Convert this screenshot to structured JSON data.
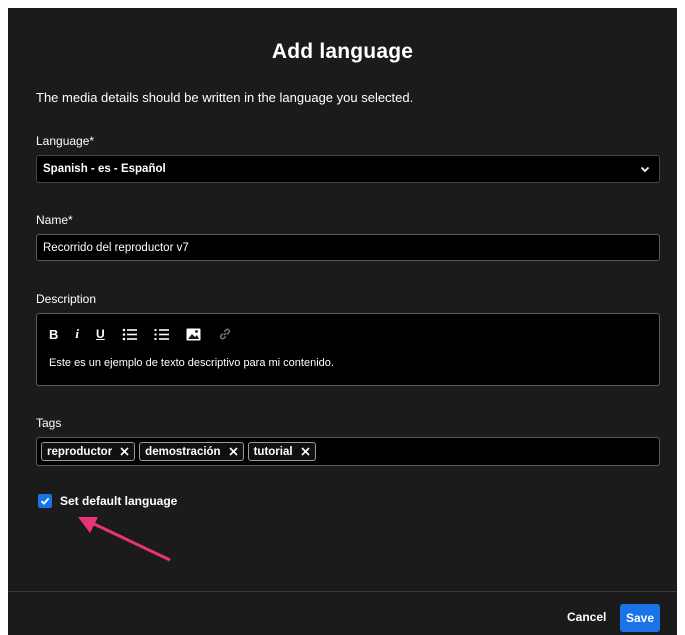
{
  "dialog": {
    "title": "Add language",
    "subtitle": "The media details should be written in the language you selected."
  },
  "language": {
    "label": "Language",
    "required_mark": "*",
    "value": "Spanish - es - Español",
    "icon": "chevron-down-icon"
  },
  "name": {
    "label": "Name",
    "required_mark": "*",
    "value": "Recorrido del reproductor v7"
  },
  "description": {
    "label": "Description",
    "toolbar": {
      "bold": "B",
      "italic": "i",
      "underline": "U",
      "bullet_list_icon": "bullet-list-icon",
      "numbered_list_icon": "numbered-list-icon",
      "image_icon": "image-icon",
      "link_icon": "link-icon"
    },
    "text": "Este es un ejemplo de texto descriptivo para mi contenido."
  },
  "tags": {
    "label": "Tags",
    "items": [
      "reproductor",
      "demostración",
      "tutorial"
    ]
  },
  "default_language": {
    "label": "Set default language",
    "checked": true
  },
  "footer": {
    "cancel_label": "Cancel",
    "save_label": "Save"
  },
  "colors": {
    "background": "#1b1b1b",
    "accent": "#1a73e8",
    "annotation_arrow": "#e8337a"
  }
}
